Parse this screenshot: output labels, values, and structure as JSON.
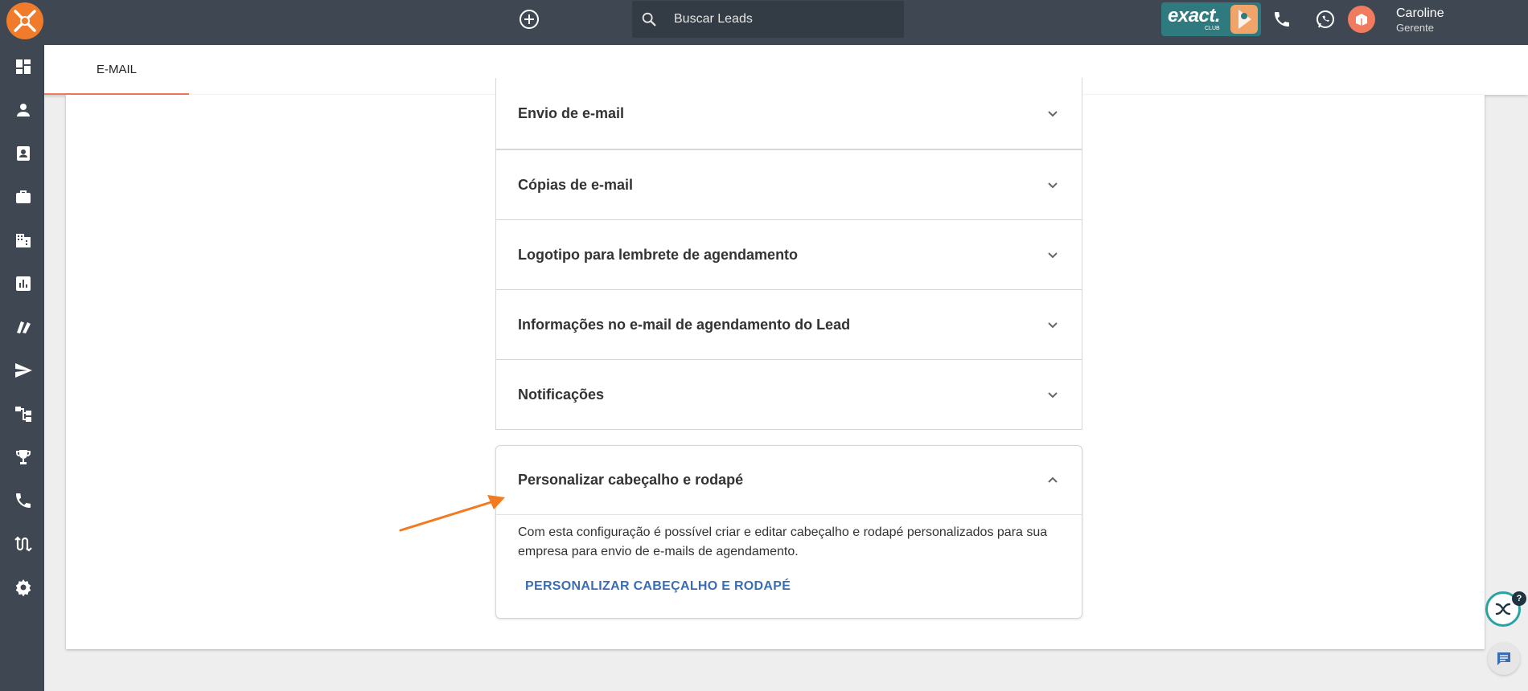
{
  "header": {
    "search_placeholder": "Buscar Leads",
    "exact_badge_text": "exact.",
    "exact_badge_sub": "CLUB",
    "user_name": "Caroline",
    "user_role": "Gerente"
  },
  "icons": {
    "logo": "company-logo",
    "add": "add-circle-icon",
    "search": "search-icon",
    "phone": "phone-icon",
    "whatsapp": "whatsapp-icon",
    "avatar": "user-avatar"
  },
  "sidebar": {
    "items": [
      {
        "name": "dashboard-icon"
      },
      {
        "name": "person-icon"
      },
      {
        "name": "contacts-icon"
      },
      {
        "name": "briefcase-icon"
      },
      {
        "name": "company-icon"
      },
      {
        "name": "reports-icon"
      },
      {
        "name": "products-icon"
      },
      {
        "name": "send-icon"
      },
      {
        "name": "workflow-icon"
      },
      {
        "name": "trophy-icon"
      },
      {
        "name": "phone-icon"
      },
      {
        "name": "integration-icon"
      },
      {
        "name": "settings-icon"
      }
    ]
  },
  "tabs": [
    {
      "label": "E-MAIL",
      "active": true
    }
  ],
  "panels": [
    {
      "title": "Envio de e-mail",
      "expanded": false
    },
    {
      "title": "Cópias de e-mail",
      "expanded": false
    },
    {
      "title": "Logotipo para lembrete de agendamento",
      "expanded": false
    },
    {
      "title": "Informações no e-mail de agendamento do Lead",
      "expanded": false
    },
    {
      "title": "Notificações",
      "expanded": false
    }
  ],
  "open_panel": {
    "title": "Personalizar cabeçalho e rodapé",
    "description": "Com esta configuração é possível criar e editar cabeçalho e rodapé personalizados para sua empresa para envio de e-mails de agendamento.",
    "link_label": "PERSONALIZAR CABEÇALHO E RODAPÉ"
  },
  "floating": {
    "help_badge": "?"
  },
  "colors": {
    "topbar": "#3e4752",
    "accent_orange": "#f07b2a",
    "link_blue": "#3b6db3",
    "tab_underline": "#f07b5f"
  }
}
